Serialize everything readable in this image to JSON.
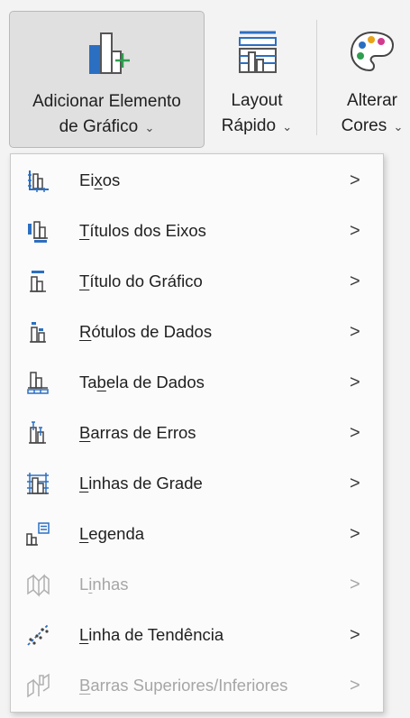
{
  "ribbon": {
    "add_chart_element": {
      "line1": "Adicionar Elemento",
      "line2": "de Gráfico"
    },
    "quick_layout": {
      "line1": "Layout",
      "line2": "Rápido"
    },
    "change_colors": {
      "line1": "Alterar",
      "line2": "Cores"
    },
    "chevron": "⌄"
  },
  "menu": {
    "items": [
      {
        "pre": "Ei",
        "key": "x",
        "post": "os",
        "icon": "axes-icon",
        "enabled": true
      },
      {
        "pre": "",
        "key": "T",
        "post": "ítulos dos Eixos",
        "icon": "axis-titles-icon",
        "enabled": true
      },
      {
        "pre": "",
        "key": "T",
        "post": "ítulo do Gráfico",
        "icon": "chart-title-icon",
        "enabled": true
      },
      {
        "pre": "",
        "key": "R",
        "post": "ótulos de Dados",
        "icon": "data-labels-icon",
        "enabled": true
      },
      {
        "pre": "Ta",
        "key": "b",
        "post": "ela de Dados",
        "icon": "data-table-icon",
        "enabled": true
      },
      {
        "pre": "",
        "key": "B",
        "post": "arras de Erros",
        "icon": "error-bars-icon",
        "enabled": true
      },
      {
        "pre": "",
        "key": "L",
        "post": "inhas de Grade",
        "icon": "gridlines-icon",
        "enabled": true
      },
      {
        "pre": "",
        "key": "L",
        "post": "egenda",
        "icon": "legend-icon",
        "enabled": true
      },
      {
        "pre": "L",
        "key": "i",
        "post": "nhas",
        "icon": "lines-icon",
        "enabled": false
      },
      {
        "pre": "",
        "key": "L",
        "post": "inha de Tendência",
        "icon": "trendline-icon",
        "enabled": true
      },
      {
        "pre": "",
        "key": "B",
        "post": "arras Superiores/Inferiores",
        "icon": "up-down-bars-icon",
        "enabled": false
      }
    ],
    "arrow": ">"
  },
  "colors": {
    "accent_blue": "#2b6fc2",
    "accent_green": "#2e9e4f",
    "disabled_text": "#a6a6a6"
  }
}
